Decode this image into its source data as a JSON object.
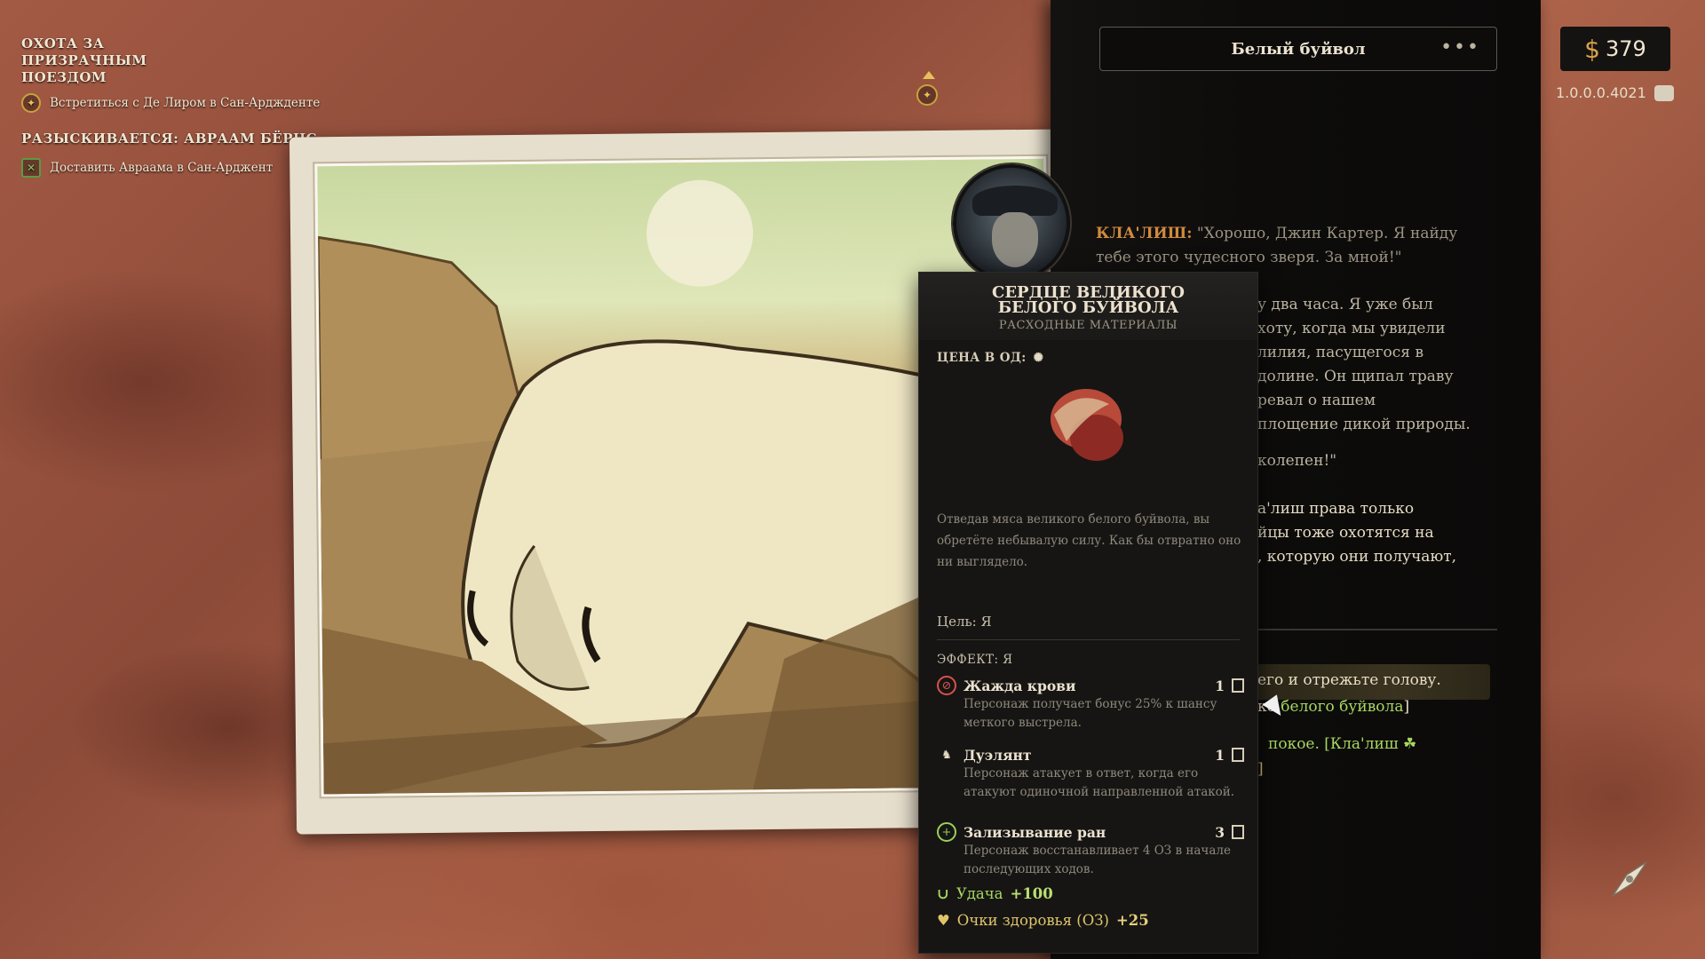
{
  "quests": [
    {
      "title": "ОХОТА ЗА ПРИЗРАЧНЫМ ПОЕЗДОМ",
      "task": "Встретиться с Де Лиром в Сан-Арджденте",
      "icon": "quest-compass-icon"
    },
    {
      "title": "РАЗЫСКИВАЕТСЯ: АВРААМ БЁРНС",
      "task": "Доставить Авраама в Сан-Арджент",
      "icon": "wanted-poster-icon"
    }
  ],
  "panel": {
    "title": "Белый буйвол",
    "dialog_speaker": "КЛА'ЛИШ:",
    "dialog_quote": "\"Хорошо, Джин Картер. Я найду тебе этого чудесного зверя. За мной!\"",
    "story_lines": [
      "у два часа. Я уже был",
      "хоту, когда мы увидели",
      "лилия, пасущегося в",
      "долине. Он щипал траву",
      "ревал о нашем",
      "площение дикой природы.",
      "колепен!\"",
      "а'лиш права только",
      "йцы тоже охотятся на",
      ", которую они получают,"
    ],
    "option1": "его и отрежьте голову.",
    "option2_prefix": "ко",
    "option2_green": "белого буйвола",
    "option2_suffix": "]",
    "option3_text": "покое. [Кла'лиш",
    "option4": "]"
  },
  "money": {
    "currency": "$",
    "value": "379"
  },
  "version": "1.0.0.0.4021",
  "tooltip": {
    "name": "СЕРДЦЕ ВЕЛИКОГО БЕЛОГО БУЙВОЛА",
    "category": "РАСХОДНЫЕ МАТЕРИАЛЫ",
    "price_label": "ЦЕНА В ОД:",
    "description": "Отведав мяса великого белого буйвола, вы обретёте небывалую силу. Как бы отвратно оно ни выглядело.",
    "target": "Цель: Я",
    "effect_header": "ЭФФЕКТ: Я",
    "effects": [
      {
        "name": "Жажда крови",
        "turns": "1",
        "desc": "Персонаж получает бонус 25% к шансу меткого выстрела.",
        "icon": "bloodthirst-icon",
        "color": "#d8524a"
      },
      {
        "name": "Дуэлянт",
        "turns": "1",
        "desc": "Персонаж атакует в ответ, когда его атакуют одиночной направленной атакой.",
        "icon": "duelist-icon",
        "color": "#e6dcc6"
      },
      {
        "name": "Зализывание ран",
        "turns": "3",
        "desc": "Персонаж восстанавливает 4 ОЗ в начале последующих ходов.",
        "icon": "heal-icon",
        "color": "#9ad05a"
      }
    ],
    "stats": [
      {
        "label": "Удача",
        "value": "+100",
        "icon": "horseshoe-icon",
        "color": "#a8d860"
      },
      {
        "label": "Очки здоровья (ОЗ)",
        "value": "+25",
        "icon": "heart-icon",
        "color": "#e0c46a"
      }
    ]
  }
}
